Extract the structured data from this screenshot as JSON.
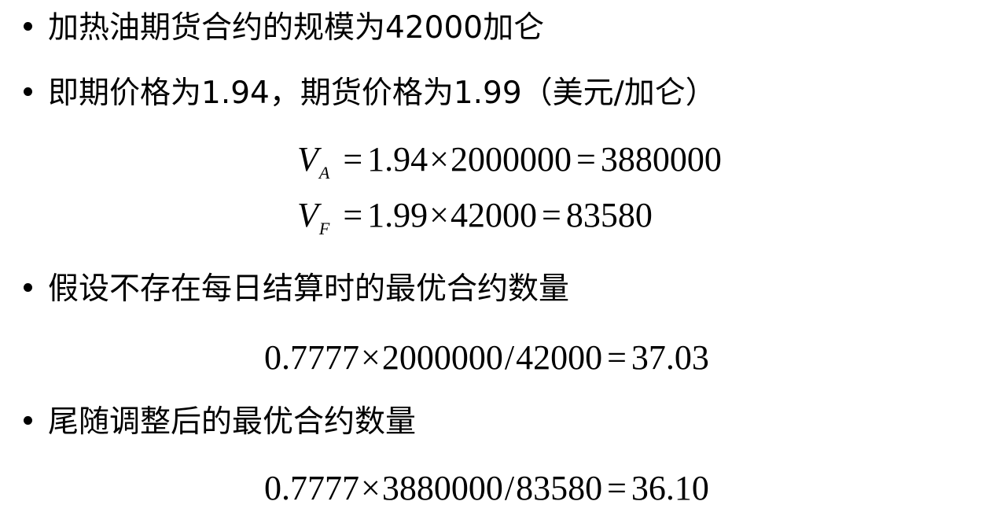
{
  "bullets": [
    {
      "text": "加热油期货合约的规模为42000加仑"
    },
    {
      "text": "即期价格为1.94，期货价格为1.99（美元/加仑）"
    },
    {
      "text": "假设不存在每日结算时的最优合约数量"
    },
    {
      "text": "尾随调整后的最优合约数量"
    }
  ],
  "equations": {
    "va": {
      "var": "V",
      "sub": "A",
      "eq1": "=",
      "a": "1.94",
      "times": "×",
      "b": "2000000",
      "eq2": "=",
      "result": "3880000"
    },
    "vf": {
      "var": "V",
      "sub": "F",
      "eq1": "=",
      "a": "1.99",
      "times": "×",
      "b": "42000",
      "eq2": "=",
      "result": "83580"
    },
    "no_settle": {
      "a": "0.7777",
      "times": "×",
      "b": "2000000",
      "div": "/",
      "c": "42000",
      "eq": "=",
      "result": "37.03"
    },
    "tailing": {
      "a": "0.7777",
      "times": "×",
      "b": "3880000",
      "div": "/",
      "c": "83580",
      "eq": "=",
      "result": "36.10"
    }
  }
}
